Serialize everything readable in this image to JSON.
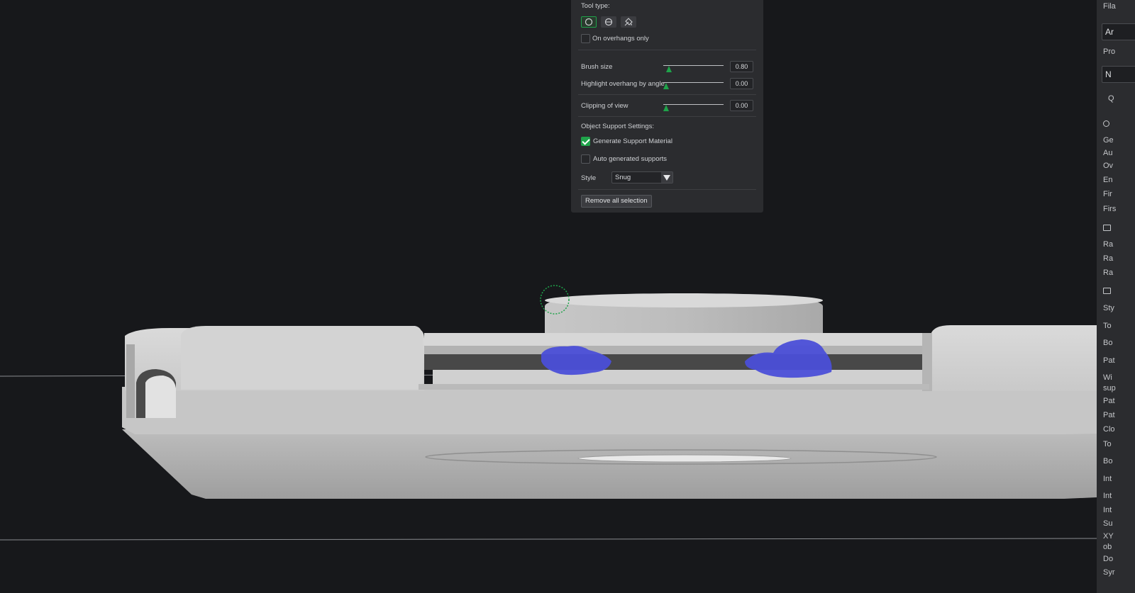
{
  "tool_panel": {
    "tool_type_label": "Tool type:",
    "tools": [
      {
        "icon": "circle-icon",
        "active": true
      },
      {
        "icon": "sphere-icon",
        "active": false
      },
      {
        "icon": "fill-bucket-icon",
        "active": false
      }
    ],
    "on_overhangs_only": {
      "label": "On overhangs only",
      "checked": false
    },
    "brush_size": {
      "label": "Brush size",
      "value": "0.80",
      "fraction": 0.1
    },
    "highlight_overhang": {
      "label": "Highlight overhang by angle",
      "value": "0.00",
      "fraction": 0.0
    },
    "clipping_of_view": {
      "label": "Clipping of view",
      "value": "0.00",
      "fraction": 0.0
    },
    "object_support_settings_label": "Object Support Settings:",
    "generate_support_material": {
      "label": "Generate Support Material",
      "checked": true
    },
    "auto_generated_supports": {
      "label": "Auto generated supports",
      "checked": false
    },
    "style": {
      "label": "Style",
      "value": "Snug"
    },
    "remove_all_selection_label": "Remove all selection"
  },
  "sidebar": {
    "items": [
      {
        "text": "Fila",
        "kind": "header"
      },
      {
        "text": "Ar",
        "kind": "field"
      },
      {
        "text": "Pro",
        "kind": "header"
      },
      {
        "text": "N",
        "kind": "field"
      },
      {
        "text": "Q",
        "kind": "search"
      },
      {
        "text": "Ge"
      },
      {
        "text": "Au"
      },
      {
        "text": "Ov"
      },
      {
        "text": "En"
      },
      {
        "text": "Fir"
      },
      {
        "text": "Firs"
      },
      {
        "text": "Ra"
      },
      {
        "text": "Ra"
      },
      {
        "text": "Ra"
      },
      {
        "text": "Sty"
      },
      {
        "text": "To"
      },
      {
        "text": "Bo"
      },
      {
        "text": "Pat"
      },
      {
        "text": "Wi"
      },
      {
        "text": "sup"
      },
      {
        "text": "Pat"
      },
      {
        "text": "Pat"
      },
      {
        "text": "Clo"
      },
      {
        "text": "To"
      },
      {
        "text": "Bo"
      },
      {
        "text": "Int"
      },
      {
        "text": "Int"
      },
      {
        "text": "Int"
      },
      {
        "text": "Su"
      },
      {
        "text": "XY"
      },
      {
        "text": "ob"
      },
      {
        "text": "Do"
      },
      {
        "text": "Syr"
      }
    ]
  },
  "colors": {
    "accent": "#1fa34a",
    "paint": "#4b4fd8",
    "model": "#c8c8c8",
    "background": "#17181b",
    "panel": "#2b2c2f"
  }
}
